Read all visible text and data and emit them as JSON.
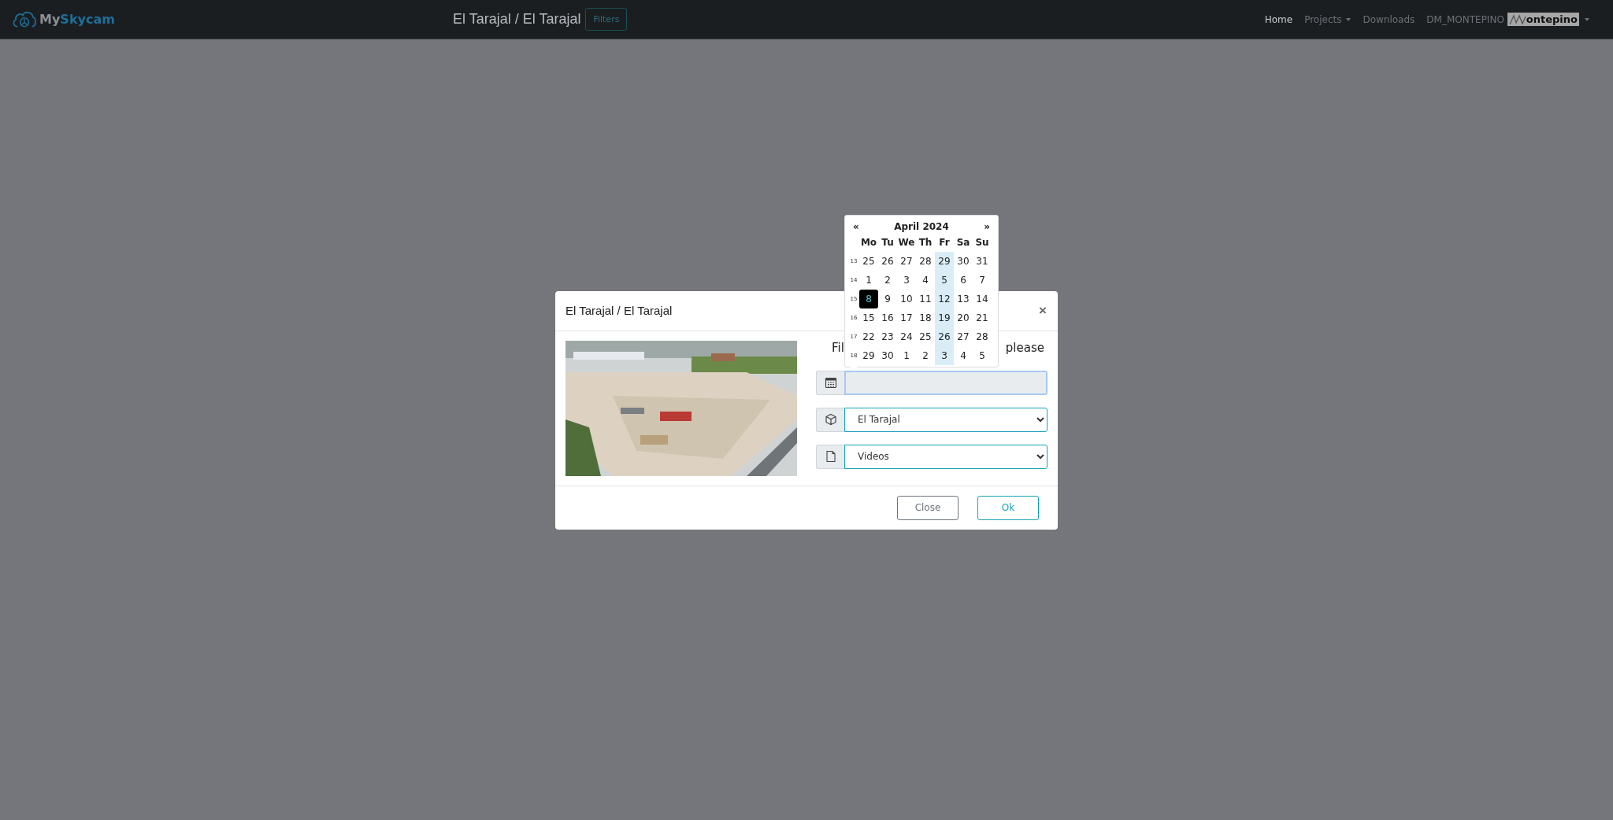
{
  "navbar": {
    "brand": {
      "prefix": "My",
      "name": "Skycam"
    },
    "title": "El Tarajal / El Tarajal",
    "filters_button": "Filters",
    "links": [
      {
        "label": "Home",
        "selected": true,
        "dropdown": false
      },
      {
        "label": "Projects",
        "selected": false,
        "dropdown": true
      },
      {
        "label": "Downloads",
        "selected": false,
        "dropdown": false
      },
      {
        "label": "DM_MONTEPINO",
        "selected": false,
        "dropdown": false
      }
    ],
    "user_logo_text": "ontepino"
  },
  "modal": {
    "title": "El Tarajal / El Tarajal",
    "close": "×",
    "picture": {
      "kind": "picture"
    },
    "heading_parts": [
      "Fil",
      "please"
    ],
    "fields": [
      {
        "kind": "date"
      },
      {
        "kind": "project-select",
        "value": "El Tarajal"
      },
      {
        "kind": "type-select",
        "value": "Videos"
      }
    ],
    "buttons": [
      {
        "label": "Close",
        "kind": "secondary"
      },
      {
        "label": "Ok",
        "kind": "primary"
      }
    ]
  },
  "calendar": {
    "prev": "«",
    "title": "April 2024",
    "next": "»",
    "weekdays": [
      "Mo",
      "Tu",
      "We",
      "Th",
      "Fr",
      "Sa",
      "Su"
    ],
    "weeks": [
      {
        "number": "13",
        "days": [
          {
            "label": "25",
            "selected": false,
            "highlighted": false
          },
          {
            "label": "26",
            "selected": false,
            "highlighted": false
          },
          {
            "label": "27",
            "selected": false,
            "highlighted": false
          },
          {
            "label": "28",
            "selected": false,
            "highlighted": false
          },
          {
            "label": "29",
            "selected": false,
            "highlighted": true
          },
          {
            "label": "30",
            "selected": false,
            "highlighted": false
          },
          {
            "label": "31",
            "selected": false,
            "highlighted": false
          }
        ]
      },
      {
        "number": "14",
        "days": [
          {
            "label": "1",
            "selected": false,
            "highlighted": false
          },
          {
            "label": "2",
            "selected": false,
            "highlighted": false
          },
          {
            "label": "3",
            "selected": false,
            "highlighted": false
          },
          {
            "label": "4",
            "selected": false,
            "highlighted": false
          },
          {
            "label": "5",
            "selected": false,
            "highlighted": true
          },
          {
            "label": "6",
            "selected": false,
            "highlighted": false
          },
          {
            "label": "7",
            "selected": false,
            "highlighted": false
          }
        ]
      },
      {
        "number": "15",
        "days": [
          {
            "label": "8",
            "selected": true,
            "highlighted": false
          },
          {
            "label": "9",
            "selected": false,
            "highlighted": false
          },
          {
            "label": "10",
            "selected": false,
            "highlighted": false
          },
          {
            "label": "11",
            "selected": false,
            "highlighted": false
          },
          {
            "label": "12",
            "selected": false,
            "highlighted": true
          },
          {
            "label": "13",
            "selected": false,
            "highlighted": false
          },
          {
            "label": "14",
            "selected": false,
            "highlighted": false
          }
        ]
      },
      {
        "number": "16",
        "days": [
          {
            "label": "15",
            "selected": false,
            "highlighted": false
          },
          {
            "label": "16",
            "selected": false,
            "highlighted": false
          },
          {
            "label": "17",
            "selected": false,
            "highlighted": false
          },
          {
            "label": "18",
            "selected": false,
            "highlighted": false
          },
          {
            "label": "19",
            "selected": false,
            "highlighted": true
          },
          {
            "label": "20",
            "selected": false,
            "highlighted": false
          },
          {
            "label": "21",
            "selected": false,
            "highlighted": false
          }
        ]
      },
      {
        "number": "17",
        "days": [
          {
            "label": "22",
            "selected": false,
            "highlighted": false
          },
          {
            "label": "23",
            "selected": false,
            "highlighted": false
          },
          {
            "label": "24",
            "selected": false,
            "highlighted": false
          },
          {
            "label": "25",
            "selected": false,
            "highlighted": false
          },
          {
            "label": "26",
            "selected": false,
            "highlighted": true
          },
          {
            "label": "27",
            "selected": false,
            "highlighted": false
          },
          {
            "label": "28",
            "selected": false,
            "highlighted": false
          }
        ]
      },
      {
        "number": "18",
        "days": [
          {
            "label": "29",
            "selected": false,
            "highlighted": false
          },
          {
            "label": "30",
            "selected": false,
            "highlighted": false
          },
          {
            "label": "1",
            "selected": false,
            "highlighted": false
          },
          {
            "label": "2",
            "selected": false,
            "highlighted": false
          },
          {
            "label": "3",
            "selected": false,
            "highlighted": true
          },
          {
            "label": "4",
            "selected": false,
            "highlighted": false
          },
          {
            "label": "5",
            "selected": false,
            "highlighted": false
          }
        ]
      }
    ]
  }
}
